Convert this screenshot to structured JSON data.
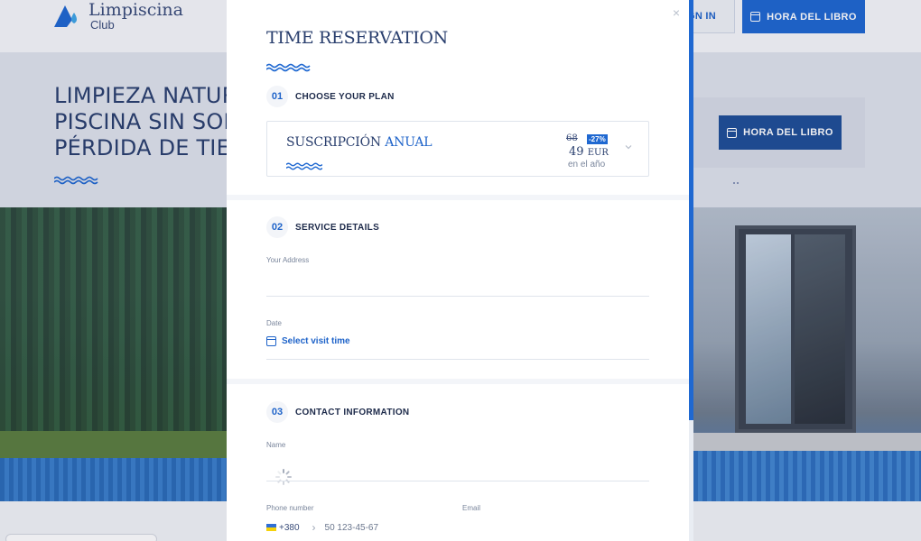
{
  "brand": {
    "name": "Limpiscina",
    "sub": "Club"
  },
  "header": {
    "signin_label": "GN IN",
    "book_label": "HORA DEL LIBRO"
  },
  "hero": {
    "title": "LIMPIEZA NATUR\nPISCINA SIN SOE\nPÉRDIDA DE TIE",
    "book_label": "HORA DEL LIBRO"
  },
  "modal": {
    "close_label": "×",
    "title": "TIME RESERVATION",
    "step1": {
      "num": "01",
      "title": "CHOOSE YOUR PLAN",
      "plan": {
        "name_prefix": "SUSCRIPCIÓN",
        "name_accent": "ANUAL",
        "old_price": "68",
        "discount": "-27%",
        "price": "49",
        "currency": "EUR",
        "period": "en el año"
      }
    },
    "step2": {
      "num": "02",
      "title": "SERVICE DETAILS",
      "address_label": "Your Address",
      "date_label": "Date",
      "date_link": "Select visit time"
    },
    "step3": {
      "num": "03",
      "title": "CONTACT INFORMATION",
      "name_label": "Name",
      "phone_label": "Phone number",
      "email_label": "Email",
      "phone_code": "+380",
      "phone_placeholder": "50 123-45-67"
    }
  },
  "colors": {
    "accent": "#1f68d1",
    "navy": "#2a3f6e",
    "text": "#1d2a4a",
    "muted": "#7a869c"
  }
}
